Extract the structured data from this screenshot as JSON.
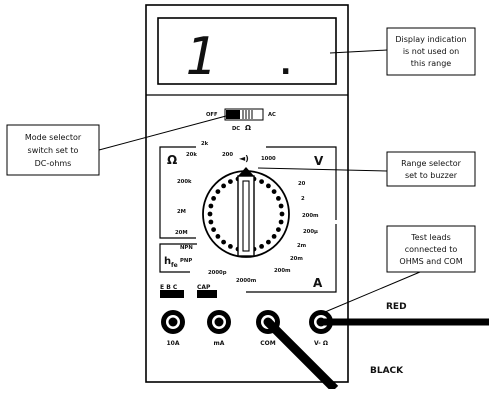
{
  "display": {
    "reading_digit": "1",
    "reading_dot": "."
  },
  "callouts": {
    "display_note": [
      "Display indication",
      "is not used on",
      "this range"
    ],
    "mode_note": [
      "Mode selector",
      "switch set to",
      "DC-ohms"
    ],
    "range_note": [
      "Range selector",
      "set to buzzer"
    ],
    "leads_note": [
      "Test leads",
      "connected to",
      "OHMS and COM"
    ]
  },
  "mode_switch": {
    "off_label": "OFF",
    "ac_label": "AC",
    "dc_label": "DC"
  },
  "sections": {
    "ohm_symbol": "Ω",
    "volt_symbol": "V",
    "amp_symbol": "A",
    "hfe_symbol": "hfe",
    "hfe_sub": "fe",
    "npn": "NPN",
    "pnp": "PNP"
  },
  "dial_labels": {
    "ohm_2k": "2k",
    "ohm_20k": "20k",
    "ohm_200k": "200k",
    "ohm_2m": "2M",
    "ohm_20m": "20M",
    "ohm_200": "200",
    "v_1000": "1000",
    "v_20": "20",
    "v_2": "2",
    "v_200m": "200m",
    "a_200u": "200µ",
    "a_2m": "2m",
    "a_20m": "20m",
    "a_200m": "200m",
    "a_2000m": "2000m",
    "cap_2000p": "2000p"
  },
  "sockets": {
    "ebc_label": "E B C",
    "cap_label": "CAP",
    "ten_a": "10A",
    "ma": "mA",
    "com": "COM",
    "v_ohm": "V- Ω"
  },
  "leads": {
    "red": "RED",
    "black": "BLACK"
  }
}
